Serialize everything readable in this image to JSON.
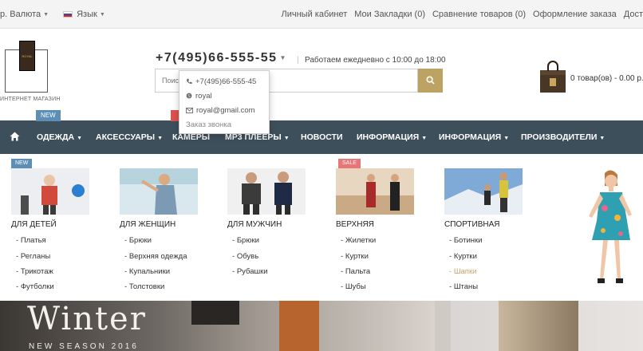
{
  "topbar": {
    "currency": "р. Валюта",
    "language": "Язык",
    "links": [
      "Личный кабинет",
      "Мои Закладки (0)",
      "Сравнение товаров (0)",
      "Оформление заказа",
      "Дост"
    ]
  },
  "header": {
    "logo_text": "ROYAL",
    "logo_caption": "ИНТЕРНЕТ МАГАЗИН",
    "phone": "+7(495)66-555-55",
    "hours": "Работаем ежедневно с 10:00 до 18:00",
    "search_placeholder": "Поиск",
    "cart": "0 товар(ов) - 0.00 р."
  },
  "phone_dropdown": {
    "phone": "+7(495)66-555-45",
    "skype": "royal",
    "email": "royal@gmail.com",
    "callback": "Заказ звонка"
  },
  "nav": {
    "badge_new": "NEW",
    "items": [
      "ОДЕЖДА",
      "АКСЕССУАРЫ",
      "КАМЕРЫ",
      "MP3 ПЛЕЕРЫ",
      "НОВОСТИ",
      "ИНФОРМАЦИЯ",
      "ИНФОРМАЦИЯ",
      "ПРОИЗВОДИТЕЛИ"
    ]
  },
  "mega_menu": {
    "tag_new": "NEW",
    "tag_sale": "SALE",
    "columns": [
      {
        "title": "ДЛЯ ДЕТЕЙ",
        "items": [
          "Платья",
          "Регланы",
          "Трикотаж",
          "Футболки"
        ]
      },
      {
        "title": "ДЛЯ ЖЕНЩИН",
        "items": [
          "Брюки",
          "Верхняя одежда",
          "Купальники",
          "Толстовки"
        ]
      },
      {
        "title": "ДЛЯ МУЖЧИН",
        "items": [
          "Брюки",
          "Обувь",
          "Рубашки"
        ]
      },
      {
        "title": "ВЕРХНЯЯ",
        "items": [
          "Жилетки",
          "Куртки",
          "Пальта",
          "Шубы"
        ]
      },
      {
        "title": "СПОРТИВНАЯ",
        "items": [
          "Ботинки",
          "Куртки",
          "Шапки",
          "Штаны"
        ]
      }
    ]
  },
  "banner": {
    "title": "Winter",
    "subtitle": "NEW SEASON 2016"
  },
  "colors": {
    "nav_bg": "#3e4f5c",
    "accent": "#bda363",
    "badge_new": "#5d8fb6",
    "badge_sale": "#e87577",
    "highlight_item": "#c7a46a"
  }
}
